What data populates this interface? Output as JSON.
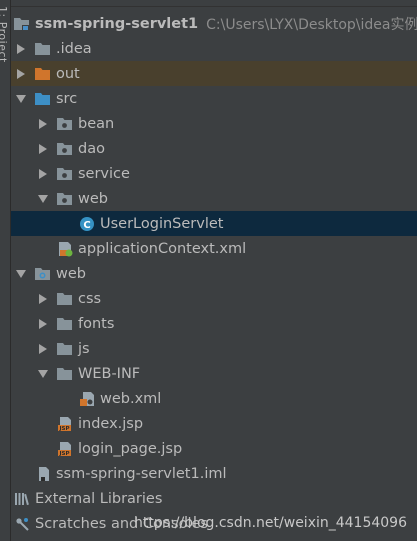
{
  "side_tab": "1: Project",
  "tree": {
    "project_name": "ssm-spring-servlet1",
    "project_path": "C:\\Users\\LYX\\Desktop\\idea实例",
    "items": {
      "idea": ".idea",
      "out": "out",
      "src": "src",
      "bean": "bean",
      "dao": "dao",
      "service": "service",
      "web_pkg": "web",
      "servlet": "UserLoginServlet",
      "app_context": "applicationContext.xml",
      "web": "web",
      "css": "css",
      "fonts": "fonts",
      "js": "js",
      "web_inf": "WEB-INF",
      "web_xml": "web.xml",
      "index_jsp": "index.jsp",
      "login_jsp": "login_page.jsp",
      "iml": "ssm-spring-servlet1.iml",
      "ext_libs": "External Libraries",
      "scratches": "Scratches and Consoles"
    }
  },
  "watermark": "https://blog.csdn.net/weixin_44154096",
  "colors": {
    "background": "#3c3f41",
    "selected_row": "#0d293e",
    "out_row": "#49402d",
    "folder": "#87939a",
    "source_folder": "#3d8fc6",
    "excluded_folder": "#d0752c"
  }
}
